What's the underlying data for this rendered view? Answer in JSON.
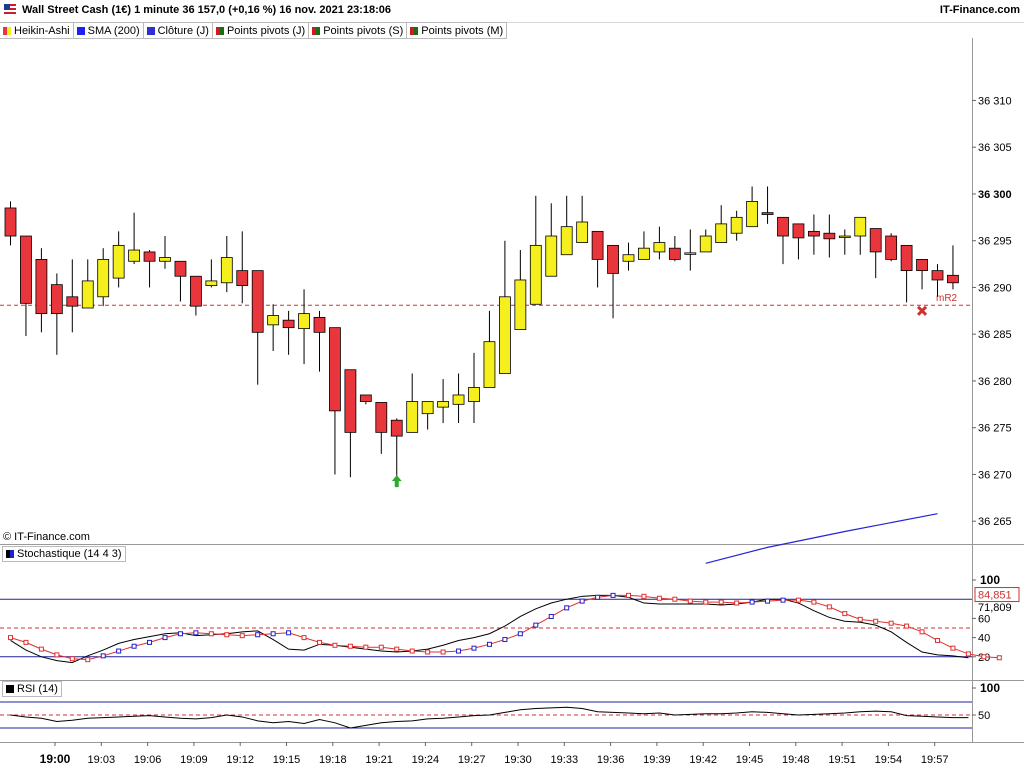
{
  "header": {
    "title": "Wall Street Cash (1€) 1 minute 36 157,0 (+0,16 %) 16 nov. 2021 23:18:06",
    "brand": "IT-Finance.com"
  },
  "legend": [
    {
      "label": "Heikin-Ashi",
      "color": "#e8363c",
      "icon": "heikin-ashi-swatch"
    },
    {
      "label": "SMA (200)",
      "color": "#2020ee",
      "icon": "sma-swatch"
    },
    {
      "label": "Clôture (J)",
      "color": "#3030d0",
      "icon": "close-swatch"
    },
    {
      "label": "Points pivots (J)",
      "color": "#1a6b1a",
      "icon": "pivot-swatch"
    },
    {
      "label": "Points pivots (S)",
      "color": "#1a6b1a",
      "icon": "pivot-swatch"
    },
    {
      "label": "Points pivots (M)",
      "color": "#1a6b1a",
      "icon": "pivot-swatch"
    }
  ],
  "copyright": "© IT-Finance.com",
  "colors": {
    "bull": "#f5ef1e",
    "bear": "#e8363c",
    "sma": "#2424d8",
    "stoch_k": "#000000",
    "stoch_d_line": "#e03030",
    "stoch_d_marker": "#2020cc",
    "rsi": "#000000",
    "pivot": "#d03030",
    "arrow": "#2ea82e"
  },
  "chart_data": [
    {
      "type": "candlestick",
      "title": "Wall Street Cash (1€) 1 minute",
      "y_ticks": [
        "36 310",
        "36 305",
        "36 300",
        "36 295",
        "36 290",
        "36 285",
        "36 280",
        "36 275",
        "36 270",
        "36 265"
      ],
      "y_tick_values": [
        36310,
        36305,
        36300,
        36295,
        36290,
        36285,
        36280,
        36275,
        36270,
        36265
      ],
      "y_bold_tick": "36 300",
      "ylim": [
        36260.5,
        36314.5
      ],
      "x_ticks": [
        "19:00",
        "19:03",
        "19:06",
        "19:09",
        "19:12",
        "19:15",
        "19:18",
        "19:21",
        "19:24",
        "19:27",
        "19:30",
        "19:33",
        "19:36",
        "19:39",
        "19:42",
        "19:45",
        "19:48",
        "19:51",
        "19:54",
        "19:57"
      ],
      "x_bold_tick": "19:00",
      "candles": [
        {
          "o": 36298.5,
          "h": 36299.2,
          "l": 36294.5,
          "c": 36295.5
        },
        {
          "o": 36295.5,
          "h": 36295.5,
          "l": 36284.8,
          "c": 36288.3
        },
        {
          "o": 36293.0,
          "h": 36294.2,
          "l": 36285.2,
          "c": 36287.2
        },
        {
          "o": 36290.3,
          "h": 36291.5,
          "l": 36282.8,
          "c": 36287.2
        },
        {
          "o": 36289.0,
          "h": 36293.0,
          "l": 36285.2,
          "c": 36288.0
        },
        {
          "o": 36287.8,
          "h": 36293.0,
          "l": 36287.8,
          "c": 36290.7
        },
        {
          "o": 36289.0,
          "h": 36294.2,
          "l": 36288.0,
          "c": 36293.0
        },
        {
          "o": 36291.0,
          "h": 36296.0,
          "l": 36290.0,
          "c": 36294.5
        },
        {
          "o": 36292.8,
          "h": 36298.0,
          "l": 36292.5,
          "c": 36294.0
        },
        {
          "o": 36293.8,
          "h": 36294.0,
          "l": 36290.0,
          "c": 36292.8
        },
        {
          "o": 36292.8,
          "h": 36295.5,
          "l": 36292.0,
          "c": 36293.2
        },
        {
          "o": 36292.8,
          "h": 36292.8,
          "l": 36288.5,
          "c": 36291.2
        },
        {
          "o": 36291.2,
          "h": 36291.2,
          "l": 36287.0,
          "c": 36288.0
        },
        {
          "o": 36290.2,
          "h": 36293.0,
          "l": 36290.0,
          "c": 36290.7
        },
        {
          "o": 36290.5,
          "h": 36295.5,
          "l": 36289.5,
          "c": 36293.2
        },
        {
          "o": 36291.8,
          "h": 36296.0,
          "l": 36288.3,
          "c": 36290.2
        },
        {
          "o": 36291.8,
          "h": 36291.8,
          "l": 36279.6,
          "c": 36285.2
        },
        {
          "o": 36286.0,
          "h": 36288.2,
          "l": 36283.2,
          "c": 36287.0
        },
        {
          "o": 36286.5,
          "h": 36287.5,
          "l": 36282.8,
          "c": 36285.7
        },
        {
          "o": 36285.6,
          "h": 36289.8,
          "l": 36281.8,
          "c": 36287.2
        },
        {
          "o": 36286.8,
          "h": 36287.5,
          "l": 36281.0,
          "c": 36285.2
        },
        {
          "o": 36285.7,
          "h": 36285.7,
          "l": 36270.0,
          "c": 36276.8
        },
        {
          "o": 36281.2,
          "h": 36281.2,
          "l": 36269.7,
          "c": 36274.5
        },
        {
          "o": 36278.5,
          "h": 36278.5,
          "l": 36277.5,
          "c": 36277.8
        },
        {
          "o": 36277.7,
          "h": 36277.7,
          "l": 36272.2,
          "c": 36274.5
        },
        {
          "o": 36275.8,
          "h": 36276.0,
          "l": 36269.7,
          "c": 36274.1
        },
        {
          "o": 36274.5,
          "h": 36280.8,
          "l": 36274.5,
          "c": 36277.8
        },
        {
          "o": 36276.5,
          "h": 36277.8,
          "l": 36274.8,
          "c": 36277.8
        },
        {
          "o": 36277.2,
          "h": 36280.2,
          "l": 36275.5,
          "c": 36277.8
        },
        {
          "o": 36277.5,
          "h": 36280.8,
          "l": 36275.5,
          "c": 36278.5
        },
        {
          "o": 36277.8,
          "h": 36283.0,
          "l": 36275.5,
          "c": 36279.3
        },
        {
          "o": 36279.3,
          "h": 36287.5,
          "l": 36279.3,
          "c": 36284.2
        },
        {
          "o": 36280.8,
          "h": 36295.0,
          "l": 36280.8,
          "c": 36289.0
        },
        {
          "o": 36285.5,
          "h": 36294.0,
          "l": 36285.5,
          "c": 36290.8
        },
        {
          "o": 36288.2,
          "h": 36299.8,
          "l": 36288.2,
          "c": 36294.5
        },
        {
          "o": 36291.2,
          "h": 36299.0,
          "l": 36291.2,
          "c": 36295.5
        },
        {
          "o": 36293.5,
          "h": 36299.8,
          "l": 36293.5,
          "c": 36296.5
        },
        {
          "o": 36294.8,
          "h": 36299.8,
          "l": 36294.8,
          "c": 36297.0
        },
        {
          "o": 36296.0,
          "h": 36296.0,
          "l": 36290.0,
          "c": 36293.0
        },
        {
          "o": 36294.5,
          "h": 36294.5,
          "l": 36286.7,
          "c": 36291.5
        },
        {
          "o": 36292.8,
          "h": 36294.8,
          "l": 36291.8,
          "c": 36293.5
        },
        {
          "o": 36293.0,
          "h": 36296.0,
          "l": 36293.0,
          "c": 36294.2
        },
        {
          "o": 36293.8,
          "h": 36296.5,
          "l": 36293.0,
          "c": 36294.8
        },
        {
          "o": 36294.2,
          "h": 36295.5,
          "l": 36292.8,
          "c": 36293.0
        },
        {
          "o": 36293.7,
          "h": 36296.2,
          "l": 36291.8,
          "c": 36293.7
        },
        {
          "o": 36293.8,
          "h": 36296.2,
          "l": 36293.8,
          "c": 36295.5
        },
        {
          "o": 36294.8,
          "h": 36298.8,
          "l": 36294.8,
          "c": 36296.8
        },
        {
          "o": 36295.8,
          "h": 36298.2,
          "l": 36295.0,
          "c": 36297.5
        },
        {
          "o": 36296.5,
          "h": 36300.8,
          "l": 36296.5,
          "c": 36299.2
        },
        {
          "o": 36298.0,
          "h": 36300.8,
          "l": 36296.8,
          "c": 36297.8
        },
        {
          "o": 36297.5,
          "h": 36297.5,
          "l": 36292.5,
          "c": 36295.5
        },
        {
          "o": 36296.8,
          "h": 36296.8,
          "l": 36293.0,
          "c": 36295.3
        },
        {
          "o": 36296.0,
          "h": 36297.8,
          "l": 36293.5,
          "c": 36295.5
        },
        {
          "o": 36295.8,
          "h": 36297.8,
          "l": 36293.2,
          "c": 36295.2
        },
        {
          "o": 36295.5,
          "h": 36296.2,
          "l": 36293.5,
          "c": 36295.5
        },
        {
          "o": 36295.5,
          "h": 36297.5,
          "l": 36293.5,
          "c": 36297.5
        },
        {
          "o": 36296.3,
          "h": 36296.3,
          "l": 36291.0,
          "c": 36293.8
        },
        {
          "o": 36295.5,
          "h": 36295.8,
          "l": 36292.8,
          "c": 36293.0
        },
        {
          "o": 36294.5,
          "h": 36294.5,
          "l": 36288.4,
          "c": 36291.8
        },
        {
          "o": 36293.0,
          "h": 36293.0,
          "l": 36289.8,
          "c": 36291.8
        },
        {
          "o": 36291.8,
          "h": 36292.5,
          "l": 36289.0,
          "c": 36290.8
        },
        {
          "o": 36291.3,
          "h": 36294.5,
          "l": 36289.8,
          "c": 36290.5
        }
      ],
      "sma200": {
        "name": "SMA (200)",
        "points": [
          [
            45.0,
            36260.5
          ],
          [
            49.0,
            36262.2
          ],
          [
            54.0,
            36263.9
          ],
          [
            60.0,
            36265.8
          ]
        ]
      },
      "pivot_level": {
        "label": "mR2",
        "value": 36288.1
      },
      "pivot_marker": {
        "index": 59,
        "value": 36287.5
      },
      "buy_arrow": {
        "index": 25,
        "value": 36269.5
      }
    },
    {
      "type": "line",
      "title": "Stochastique (14 4 3)",
      "ylim": [
        0,
        100
      ],
      "y_ticks": [
        "100",
        "60",
        "40",
        "20"
      ],
      "y_tick_values": [
        100,
        60,
        40,
        20
      ],
      "levels": [
        {
          "value": 80,
          "color": "#2020a0"
        },
        {
          "value": 50,
          "color": "#d03030",
          "dashed": true
        },
        {
          "value": 20,
          "color": "#2020a0"
        }
      ],
      "current_labels": [
        {
          "text": "84,851",
          "value": 84.85,
          "style": "red-box"
        },
        {
          "text": "71,809",
          "value": 71.81,
          "style": "plain"
        }
      ],
      "series": [
        {
          "key": "k",
          "values": [
            37,
            27,
            20,
            16,
            14,
            21,
            27,
            34,
            38,
            41,
            44,
            45,
            42,
            43,
            44,
            46,
            47,
            38,
            28,
            27,
            33,
            32,
            30,
            28,
            26,
            25,
            26,
            28,
            32,
            37,
            40,
            44,
            52,
            62,
            70,
            76,
            80,
            83,
            84,
            84,
            82,
            76,
            75,
            75,
            75,
            75,
            74,
            75,
            77,
            80,
            80,
            76,
            68,
            61,
            57,
            56,
            53,
            46,
            35,
            25,
            22,
            21,
            19
          ]
        },
        {
          "key": "d",
          "values": [
            40,
            35,
            28,
            22,
            18,
            17,
            21,
            26,
            31,
            35,
            40,
            44,
            45,
            44,
            43,
            42,
            43,
            44,
            45,
            40,
            35,
            32,
            31,
            30,
            30,
            28,
            26,
            25,
            25,
            26,
            29,
            33,
            38,
            44,
            53,
            62,
            71,
            78,
            82,
            84,
            84,
            83,
            81,
            80,
            78,
            77,
            77,
            76,
            77,
            78,
            79,
            79,
            77,
            72,
            65,
            59,
            57,
            55,
            52,
            46,
            37,
            29,
            23,
            20,
            19
          ]
        }
      ]
    },
    {
      "type": "line",
      "title": "RSI (14)",
      "ylim": [
        0,
        100
      ],
      "y_ticks": [
        "100",
        "50"
      ],
      "y_tick_values": [
        100,
        50
      ],
      "levels": [
        {
          "value": 70,
          "color": "#2020a0"
        },
        {
          "value": 50,
          "color": "#d03030",
          "dashed": true
        },
        {
          "value": 30,
          "color": "#2020a0"
        }
      ],
      "series": [
        {
          "key": "rsi",
          "values": [
            50,
            47,
            45,
            40,
            42,
            45,
            46,
            47,
            48,
            49,
            47,
            45,
            44,
            46,
            50,
            47,
            41,
            38,
            40,
            37,
            43,
            38,
            30,
            34,
            38,
            40,
            41,
            44,
            45,
            47,
            49,
            50,
            54,
            58,
            60,
            61,
            62,
            60,
            55,
            54,
            53,
            52,
            53,
            50,
            51,
            52,
            52,
            53,
            55,
            54,
            52,
            50,
            51,
            52,
            53,
            55,
            56,
            55,
            49,
            48,
            47,
            46,
            46
          ]
        }
      ]
    }
  ]
}
